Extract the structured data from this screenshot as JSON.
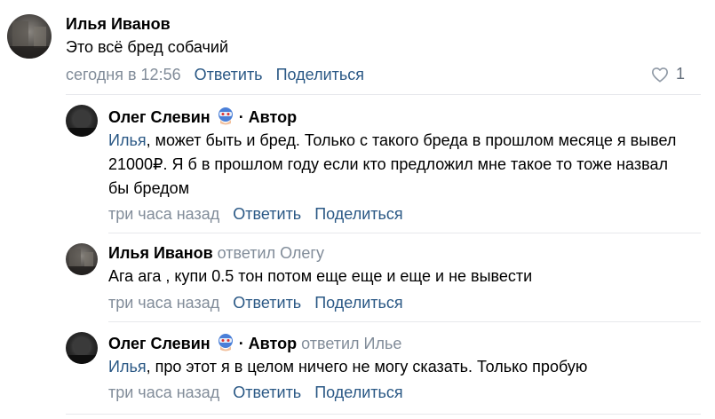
{
  "comments": [
    {
      "author": "Илья Иванов",
      "text": "Это всё бред собачий",
      "time": "сегодня в 12:56",
      "reply_label": "Ответить",
      "share_label": "Поделиться",
      "likes": "1",
      "avatar": "dark-photo"
    },
    {
      "author": "Олег Слевин",
      "role": "· Автор",
      "mention": "Илья",
      "text": ", может быть и бред. Только с такого бреда в прошлом месяце я вывел 21000₽. Я б в прошлом году если кто предложил мне такое то тоже назвал бы бредом",
      "time": "три часа назад",
      "reply_label": "Ответить",
      "share_label": "Поделиться",
      "badge": "blue-mask-icon"
    },
    {
      "author": "Илья Иванов",
      "replied_to": "ответил Олегу",
      "text": "Ага ага , купи 0.5 тон потом еще еще и еще и не вывести",
      "time": "три часа назад",
      "reply_label": "Ответить",
      "share_label": "Поделиться"
    },
    {
      "author": "Олег Слевин",
      "role": "· Автор",
      "replied_to": "ответил Илье",
      "mention": "Илья",
      "text": ", про этот я в целом ничего не могу сказать. Только пробую",
      "time": "три часа назад",
      "reply_label": "Ответить",
      "share_label": "Поделиться",
      "badge": "blue-mask-icon"
    }
  ],
  "colors": {
    "link": "#2a5885",
    "muted": "#818c99",
    "divider": "#e7e8ec"
  }
}
